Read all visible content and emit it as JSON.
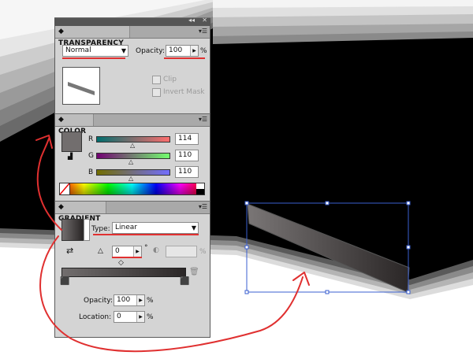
{
  "colors": {
    "accent_annotation": "#e03030",
    "selection": "#3a5fd0",
    "panel_bg": "#d4d4d4"
  },
  "transparency": {
    "title": "TRANSPARENCY",
    "blend_mode": "Normal",
    "opacity_label": "Opacity:",
    "opacity_value": "100",
    "percent": "%",
    "clip_label": "Clip",
    "invert_mask_label": "Invert Mask"
  },
  "color": {
    "title": "COLOR",
    "channels": [
      {
        "label": "R",
        "value": "114"
      },
      {
        "label": "G",
        "value": "110"
      },
      {
        "label": "B",
        "value": "110"
      }
    ],
    "swatch_hex": "#726e6e"
  },
  "gradient": {
    "title": "GRADIENT",
    "type_label": "Type:",
    "type_value": "Linear",
    "angle_value": "0",
    "degree": "°",
    "percent": "%",
    "opacity_label": "Opacity:",
    "opacity_value": "100",
    "location_label": "Location:",
    "location_value": "0"
  },
  "icons": [
    "collapse-icon",
    "panel-menu-icon",
    "dropdown-arrow-icon",
    "spin-arrow-icon",
    "out-of-gamut-icon",
    "none-swatch-icon",
    "reverse-gradient-icon",
    "angle-icon",
    "aspect-ratio-icon",
    "trash-icon",
    "gradient-stop-icon",
    "midpoint-diamond-icon"
  ]
}
